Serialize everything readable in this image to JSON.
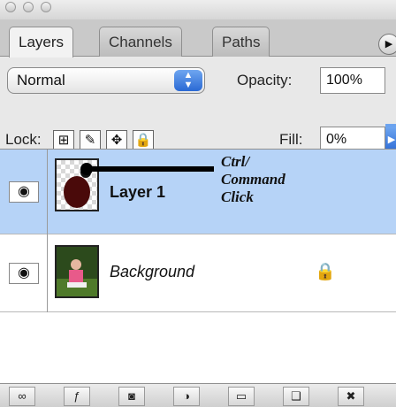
{
  "tabs": [
    {
      "label": "Layers",
      "active": true
    },
    {
      "label": "Channels",
      "active": false
    },
    {
      "label": "Paths",
      "active": false
    }
  ],
  "options": {
    "blend_mode": "Normal",
    "opacity_label": "Opacity:",
    "opacity_value": "100%",
    "lock_label": "Lock:",
    "fill_label": "Fill:",
    "fill_value": "0%"
  },
  "layers": [
    {
      "name": "Layer 1",
      "selected": true,
      "italic": false
    },
    {
      "name": "Background",
      "selected": false,
      "italic": true,
      "locked": true
    }
  ],
  "annotation": {
    "line1": "Ctrl/",
    "line2": "Command",
    "line3": "Click"
  },
  "colors": {
    "selection": "#b6d3f7",
    "accent": "#2a69d4",
    "layer_shape": "#4a0a0a"
  },
  "toolbar_icons": [
    "link-layers-icon",
    "layer-style-icon",
    "layer-mask-icon",
    "adjustment-layer-icon",
    "group-folder-icon",
    "new-layer-icon",
    "trash-icon"
  ]
}
